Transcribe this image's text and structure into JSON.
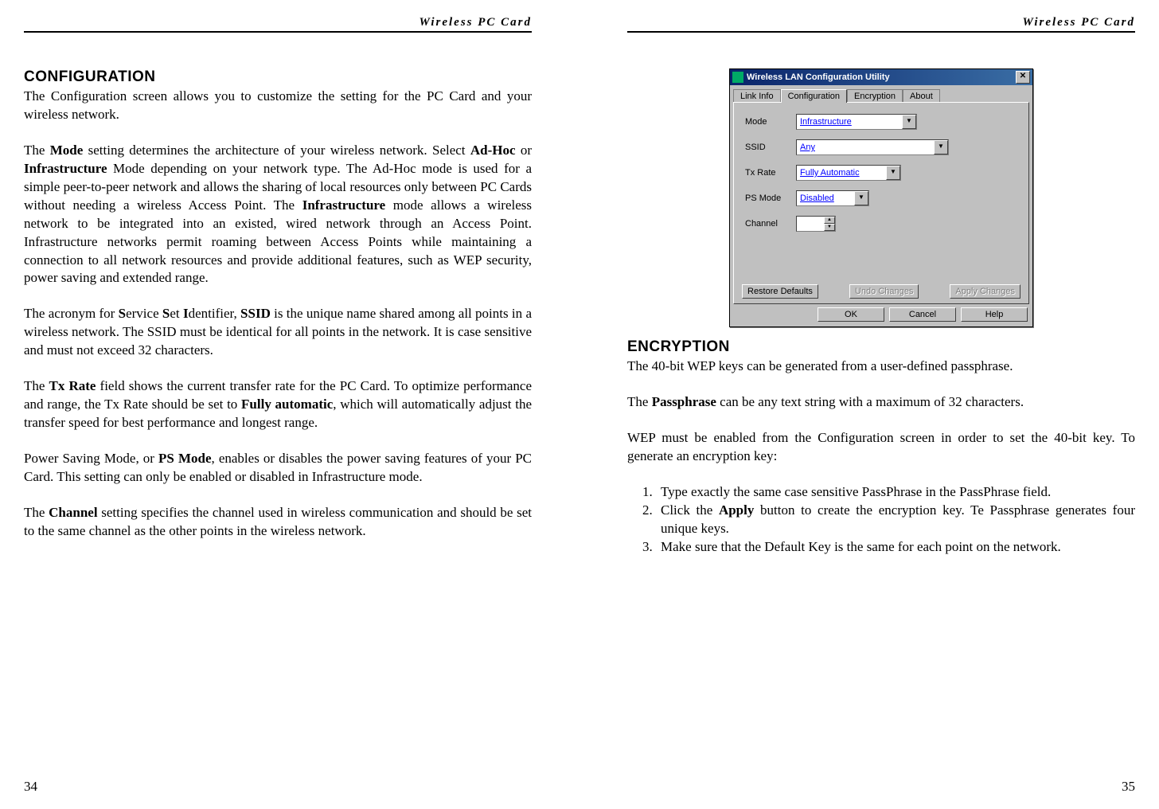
{
  "header": "Wireless PC Card",
  "left": {
    "section_title": "CONFIGURATION",
    "p1a": "The Configuration screen allows you to customize the setting for the PC Card and your wireless network.",
    "p2_pre": "The ",
    "p2_mode": "Mode",
    "p2_mid1": " setting determines the architecture of your wireless network. Select ",
    "p2_adhoc": "Ad-Hoc",
    "p2_or": " or ",
    "p2_infra": "Infrastructure",
    "p2_mid2": " Mode depending on your network type. The Ad-Hoc mode is used for a simple peer-to-peer network and allows the sharing of local resources only between PC Cards without needing a wireless Access Point. The ",
    "p2_infra2": "Infrastructure",
    "p2_tail": " mode allows a wireless network to be integrated into an existed, wired network through an Access Point. Infrastructure networks permit roaming between Access Points while maintaining a connection to all network resources and provide additional features, such as WEP security, power saving and extended range.",
    "p3_pre": "The acronym for ",
    "p3_s": "S",
    "p3_ervice": "ervice ",
    "p3_s2": "S",
    "p3_et": "et ",
    "p3_i": "I",
    "p3_dent": "dentifier, ",
    "p3_ssid": "SSID",
    "p3_tail": " is the unique name shared among all points in a wireless network. The SSID must be identical for all points in the network. It is case sensitive and must not exceed 32 characters.",
    "p4_pre": "The ",
    "p4_tx": "Tx Rate",
    "p4_mid": " field shows the current transfer rate for the PC Card. To optimize performance and range, the Tx Rate should be set to ",
    "p4_fully": "Fully automatic",
    "p4_tail": ", which will automatically adjust the transfer speed for best performance and longest range.",
    "p5_pre": "Power Saving Mode, or ",
    "p5_ps": "PS Mode",
    "p5_tail": ", enables or disables the power saving features of your PC Card. This setting can only be enabled or disabled in Infrastructure mode.",
    "p6_pre": "The ",
    "p6_ch": "Channel",
    "p6_tail": " setting specifies the channel used in wireless communication and should be set to the same channel as the other points in the wireless network.",
    "page_num": "34"
  },
  "right": {
    "win_title": "Wireless LAN Configuration Utility",
    "tabs": [
      "Link Info",
      "Configuration",
      "Encryption",
      "About"
    ],
    "labels": {
      "mode": "Mode",
      "ssid": "SSID",
      "tx": "Tx Rate",
      "ps": "PS Mode",
      "ch": "Channel"
    },
    "values": {
      "mode": "Infrastructure",
      "ssid": "Any",
      "tx": "Fully Automatic",
      "ps": "Disabled"
    },
    "btns": {
      "restore": "Restore Defaults",
      "undo": "Undo Changes",
      "apply": "Apply Changes",
      "ok": "OK",
      "cancel": "Cancel",
      "help": "Help"
    },
    "section_title": "ENCRYPTION",
    "p1": "The 40-bit WEP keys can be generated from a user-defined passphrase.",
    "p2_pre": "The ",
    "p2_pass": "Passphrase",
    "p2_tail": " can be any text string with a maximum of 32 characters.",
    "p3": "WEP must be enabled from the Configuration screen in order to set the 40-bit key. To generate an encryption key:",
    "li1": "Type exactly the same case sensitive PassPhrase in the PassPhrase field.",
    "li2_pre": "Click the ",
    "li2_apply": "Apply",
    "li2_tail": " button to create the encryption key. Te Passphrase generates four unique keys.",
    "li3": "Make sure that the Default Key is the same for each point on the network.",
    "page_num": "35"
  }
}
